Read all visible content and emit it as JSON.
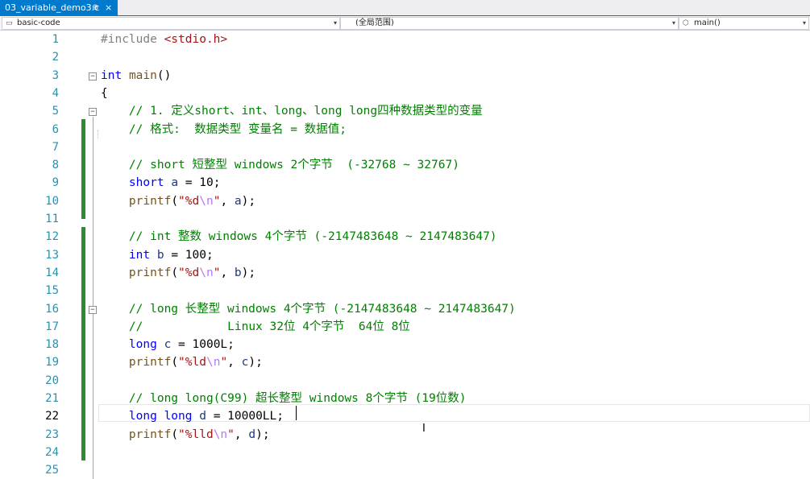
{
  "tab": {
    "title": "03_variable_demo3.c",
    "pin": "⊕",
    "close": "×"
  },
  "nav": {
    "project": "basic-code",
    "scope": "(全局范围)",
    "function": "main()"
  },
  "lines": [
    {
      "n": "1",
      "segs": [
        {
          "t": "#include ",
          "c": "p"
        },
        {
          "t": "<stdio.h>",
          "c": "s"
        }
      ]
    },
    {
      "n": "2",
      "segs": []
    },
    {
      "n": "3",
      "segs": [
        {
          "t": "int",
          "c": "k"
        },
        {
          "t": " "
        },
        {
          "t": "main",
          "c": "f"
        },
        {
          "t": "()"
        }
      ]
    },
    {
      "n": "4",
      "segs": [
        {
          "t": "{"
        }
      ]
    },
    {
      "n": "5",
      "segs": [
        {
          "t": "    // 1. 定义short、int、long、long long四种数据类型的变量",
          "c": "c"
        }
      ]
    },
    {
      "n": "6",
      "segs": [
        {
          "t": "    // 格式:  数据类型 变量名 = 数据值;",
          "c": "c"
        }
      ]
    },
    {
      "n": "7",
      "segs": []
    },
    {
      "n": "8",
      "segs": [
        {
          "t": "    // short 短整型 windows 2个字节  (-32768 ~ 32767)",
          "c": "c"
        }
      ]
    },
    {
      "n": "9",
      "segs": [
        {
          "t": "    "
        },
        {
          "t": "short",
          "c": "k"
        },
        {
          "t": " "
        },
        {
          "t": "a",
          "c": "v"
        },
        {
          "t": " = 10;"
        }
      ]
    },
    {
      "n": "10",
      "segs": [
        {
          "t": "    "
        },
        {
          "t": "printf",
          "c": "f"
        },
        {
          "t": "("
        },
        {
          "t": "\"%d",
          "c": "s"
        },
        {
          "t": "\\n",
          "c": "e"
        },
        {
          "t": "\"",
          "c": "s"
        },
        {
          "t": ", "
        },
        {
          "t": "a",
          "c": "v"
        },
        {
          "t": ");"
        }
      ]
    },
    {
      "n": "11",
      "segs": []
    },
    {
      "n": "12",
      "segs": [
        {
          "t": "    // int 整数 windows 4个字节 (-2147483648 ~ 2147483647)",
          "c": "c"
        }
      ]
    },
    {
      "n": "13",
      "segs": [
        {
          "t": "    "
        },
        {
          "t": "int",
          "c": "k"
        },
        {
          "t": " "
        },
        {
          "t": "b",
          "c": "v"
        },
        {
          "t": " = 100;"
        }
      ]
    },
    {
      "n": "14",
      "segs": [
        {
          "t": "    "
        },
        {
          "t": "printf",
          "c": "f"
        },
        {
          "t": "("
        },
        {
          "t": "\"%d",
          "c": "s"
        },
        {
          "t": "\\n",
          "c": "e"
        },
        {
          "t": "\"",
          "c": "s"
        },
        {
          "t": ", "
        },
        {
          "t": "b",
          "c": "v"
        },
        {
          "t": ");"
        }
      ]
    },
    {
      "n": "15",
      "segs": []
    },
    {
      "n": "16",
      "segs": [
        {
          "t": "    // long 长整型 windows 4个字节 (-2147483648 ~ 2147483647)",
          "c": "c"
        }
      ]
    },
    {
      "n": "17",
      "segs": [
        {
          "t": "    //            Linux 32位 4个字节  64位 8位",
          "c": "c"
        }
      ]
    },
    {
      "n": "18",
      "segs": [
        {
          "t": "    "
        },
        {
          "t": "long",
          "c": "k"
        },
        {
          "t": " "
        },
        {
          "t": "c",
          "c": "v"
        },
        {
          "t": " = 1000L;"
        }
      ]
    },
    {
      "n": "19",
      "segs": [
        {
          "t": "    "
        },
        {
          "t": "printf",
          "c": "f"
        },
        {
          "t": "("
        },
        {
          "t": "\"%ld",
          "c": "s"
        },
        {
          "t": "\\n",
          "c": "e"
        },
        {
          "t": "\"",
          "c": "s"
        },
        {
          "t": ", "
        },
        {
          "t": "c",
          "c": "v"
        },
        {
          "t": ");"
        }
      ]
    },
    {
      "n": "20",
      "segs": []
    },
    {
      "n": "21",
      "segs": [
        {
          "t": "    // long long(C99) 超长整型 windows 8个字节 (19位数)",
          "c": "c"
        }
      ]
    },
    {
      "n": "22",
      "segs": [
        {
          "t": "    "
        },
        {
          "t": "long",
          "c": "k"
        },
        {
          "t": " "
        },
        {
          "t": "long",
          "c": "k"
        },
        {
          "t": " "
        },
        {
          "t": "d",
          "c": "v"
        },
        {
          "t": " = 10000LL;"
        }
      ]
    },
    {
      "n": "23",
      "segs": [
        {
          "t": "    "
        },
        {
          "t": "printf",
          "c": "f"
        },
        {
          "t": "("
        },
        {
          "t": "\"%lld",
          "c": "s"
        },
        {
          "t": "\\n",
          "c": "e"
        },
        {
          "t": "\"",
          "c": "s"
        },
        {
          "t": ", "
        },
        {
          "t": "d",
          "c": "v"
        },
        {
          "t": ");"
        }
      ]
    },
    {
      "n": "24",
      "segs": []
    },
    {
      "n": "25",
      "segs": []
    }
  ],
  "current_line": "22",
  "folds": [
    "3",
    "5",
    "16"
  ],
  "colors": {
    "accent": "#007acc",
    "keyword": "#0000ff",
    "comment": "#008000",
    "string": "#a31515",
    "line_number": "#2b91af",
    "change_bar": "#2e8b35"
  }
}
